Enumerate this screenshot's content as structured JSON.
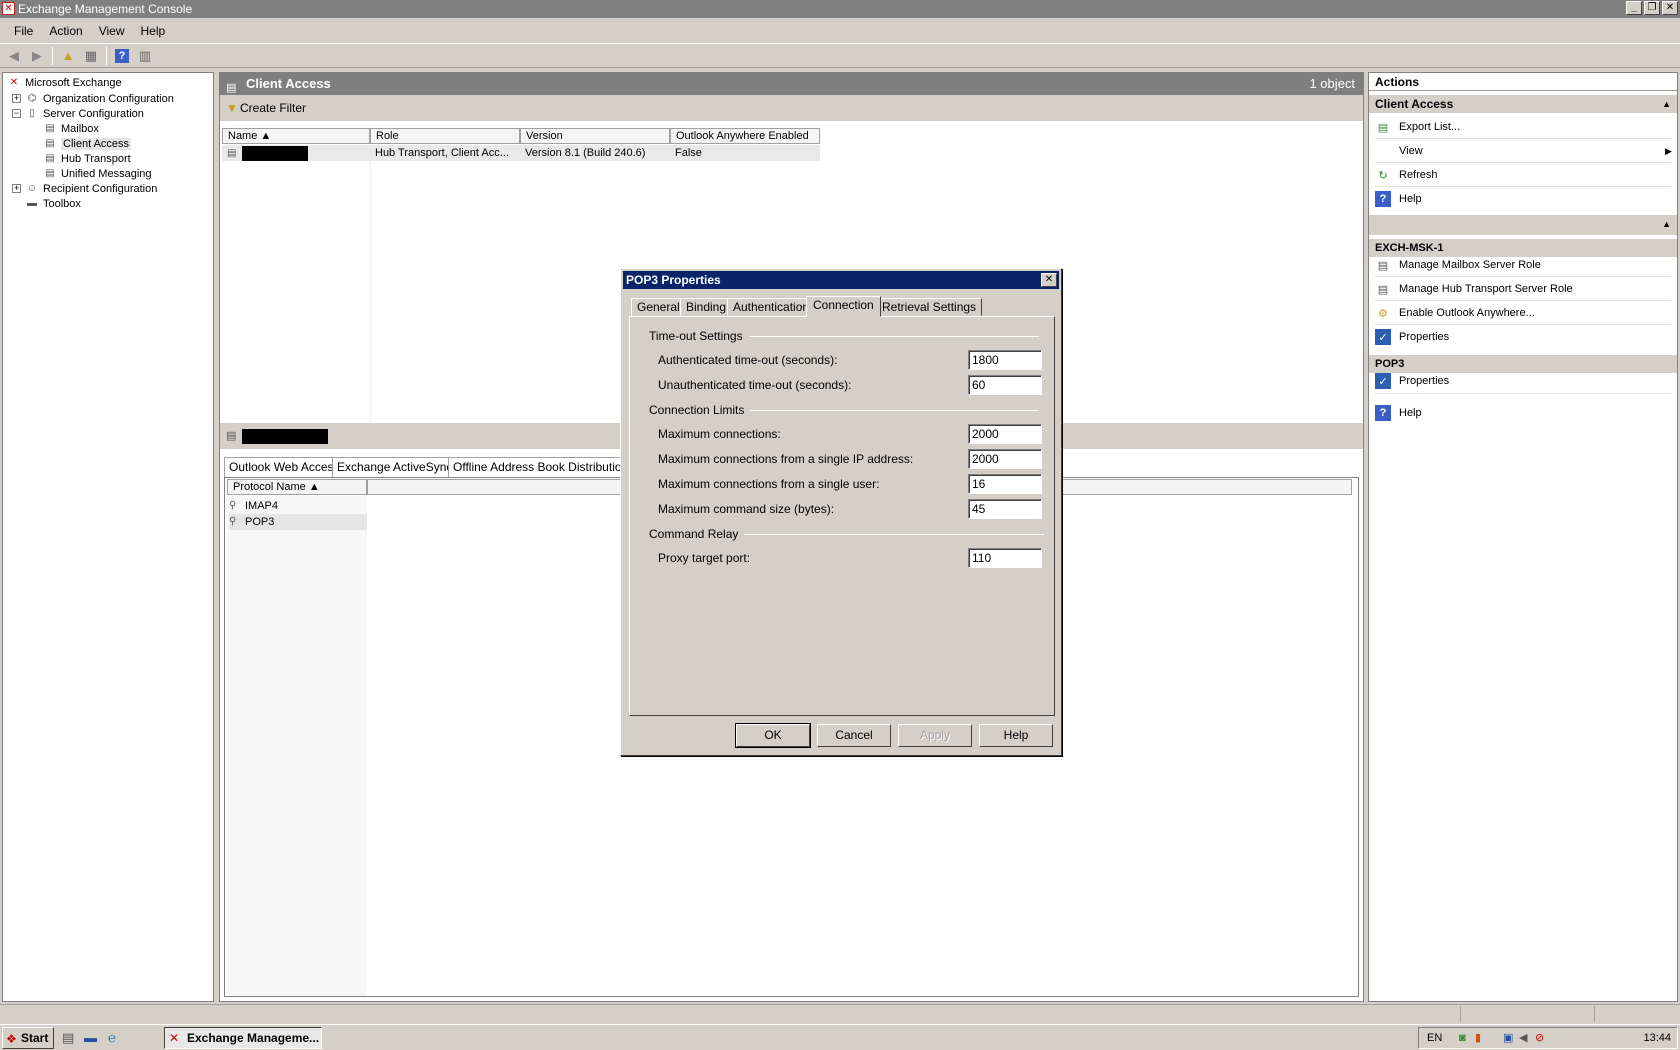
{
  "window": {
    "title": "Exchange Management Console"
  },
  "menu": {
    "items": [
      "File",
      "Action",
      "View",
      "Help"
    ]
  },
  "tree": {
    "items": [
      {
        "label": "Microsoft Exchange",
        "icon": "exchange-icon"
      },
      {
        "label": "Organization Configuration",
        "icon": "org-icon"
      },
      {
        "label": "Server Configuration",
        "icon": "server-icon"
      },
      {
        "label": "Mailbox",
        "icon": "mailbox-icon"
      },
      {
        "label": "Client Access",
        "icon": "client-access-icon"
      },
      {
        "label": "Hub Transport",
        "icon": "hub-transport-icon"
      },
      {
        "label": "Unified Messaging",
        "icon": "unified-messaging-icon"
      },
      {
        "label": "Recipient Configuration",
        "icon": "recipient-icon"
      },
      {
        "label": "Toolbox",
        "icon": "toolbox-icon"
      }
    ]
  },
  "center": {
    "title": "Client Access",
    "count": "1 object",
    "filter_label": "Create Filter",
    "columns": [
      "Name",
      "Role",
      "Version",
      "Outlook Anywhere Enabled"
    ],
    "row": {
      "role": "Hub Transport, Client Acc...",
      "version": "Version 8.1 (Build 240.6)",
      "outlook_anywhere": "False"
    },
    "subtabs": [
      "Outlook Web Access",
      "Exchange ActiveSync",
      "Offline Address Book Distribution"
    ],
    "protocol_column": "Protocol Name",
    "protocols": [
      "IMAP4",
      "POP3"
    ]
  },
  "actions": {
    "header": "Actions",
    "section1": {
      "title": "Client Access",
      "items": [
        "Export List...",
        "View",
        "Refresh",
        "Help"
      ]
    },
    "section2": {
      "title": "EXCH-MSK-1",
      "items": [
        "Manage Mailbox Server Role",
        "Manage Hub Transport Server Role",
        "Enable Outlook Anywhere...",
        "Properties"
      ]
    },
    "section3": {
      "title": "POP3",
      "items": [
        "Properties"
      ]
    },
    "help": "Help"
  },
  "dialog": {
    "title": "POP3 Properties",
    "tabs": [
      "General",
      "Binding",
      "Authentication",
      "Connection",
      "Retrieval Settings"
    ],
    "active_tab": "Connection",
    "groups": {
      "timeout": "Time-out Settings",
      "limits": "Connection Limits",
      "relay": "Command Relay"
    },
    "fields": {
      "auth_timeout": {
        "label": "Authenticated time-out (seconds):",
        "value": "1800"
      },
      "unauth_timeout": {
        "label": "Unauthenticated time-out (seconds):",
        "value": "60"
      },
      "max_conn": {
        "label": "Maximum connections:",
        "value": "2000"
      },
      "max_conn_ip": {
        "label": "Maximum connections from a single IP address:",
        "value": "2000"
      },
      "max_conn_user": {
        "label": "Maximum connections from a single user:",
        "value": "16"
      },
      "max_cmd": {
        "label": "Maximum command size (bytes):",
        "value": "45"
      },
      "proxy_port": {
        "label": "Proxy target port:",
        "value": "110"
      }
    },
    "buttons": {
      "ok": "OK",
      "cancel": "Cancel",
      "apply": "Apply",
      "help": "Help"
    }
  },
  "taskbar": {
    "start": "Start",
    "task": "Exchange Manageme...",
    "lang": "EN",
    "clock": "13:44"
  }
}
